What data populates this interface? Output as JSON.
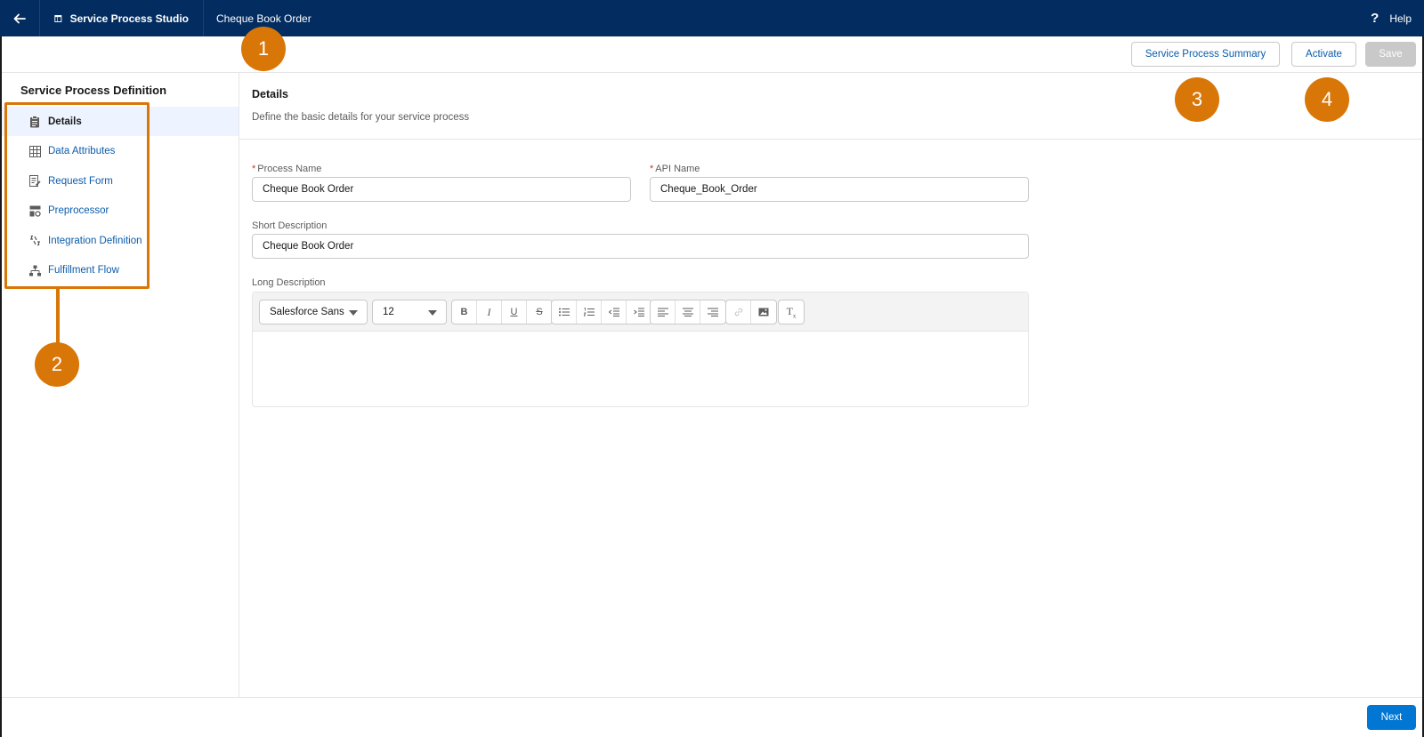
{
  "topbar": {
    "back_icon": "arrow-left-icon",
    "app_icon": "layout-icon",
    "app_title": "Service Process Studio",
    "record_title": "Cheque Book Order",
    "help_label": "Help",
    "help_icon": "question-icon"
  },
  "actions": {
    "summary_label": "Service Process Summary",
    "activate_label": "Activate",
    "save_label": "Save"
  },
  "sidebar": {
    "title": "Service Process Definition",
    "items": [
      {
        "label": "Details",
        "icon": "clipboard-icon",
        "active": true
      },
      {
        "label": "Data Attributes",
        "icon": "table-icon",
        "active": false
      },
      {
        "label": "Request Form",
        "icon": "form-icon",
        "active": false
      },
      {
        "label": "Preprocessor",
        "icon": "preprocessor-icon",
        "active": false
      },
      {
        "label": "Integration Definition",
        "icon": "integration-icon",
        "active": false
      },
      {
        "label": "Fulfillment Flow",
        "icon": "flow-icon",
        "active": false
      }
    ]
  },
  "details": {
    "title": "Details",
    "subtitle": "Define the basic details for your service process",
    "process_name_label": "Process Name",
    "process_name_value": "Cheque Book Order",
    "api_name_label": "API Name",
    "api_name_value": "Cheque_Book_Order",
    "short_desc_label": "Short Description",
    "short_desc_value": "Cheque Book Order",
    "long_desc_label": "Long Description",
    "font_family_value": "Salesforce Sans",
    "font_size_value": "12",
    "long_desc_value": ""
  },
  "footer": {
    "next_label": "Next"
  },
  "callouts": [
    "1",
    "2",
    "3",
    "4"
  ],
  "colors": {
    "topbar": "#032d60",
    "accent": "#0176d3",
    "callout": "#d97608",
    "link": "#0b5cab"
  }
}
